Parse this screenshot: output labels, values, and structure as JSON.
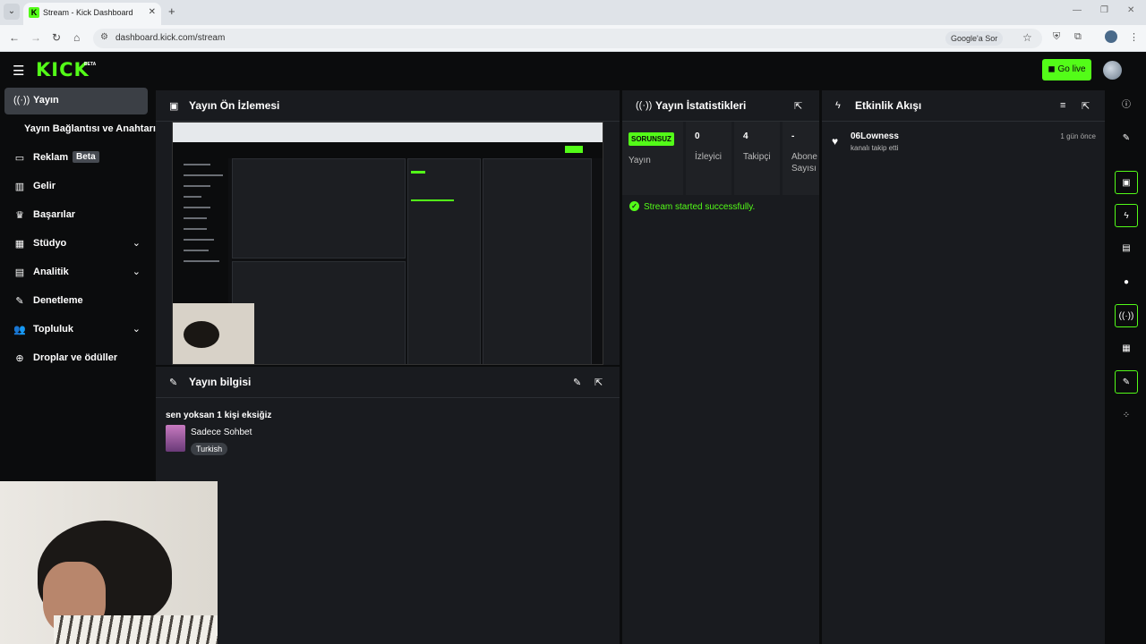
{
  "browser": {
    "tab_title": "Stream - Kick Dashboard",
    "url": "dashboard.kick.com/stream",
    "lens_chip": "Google'a Sor"
  },
  "header": {
    "logo": "KICK",
    "logo_badge": "BETA",
    "go_live_label": "Go live"
  },
  "sidebar": {
    "items": [
      {
        "label": "Yayın",
        "icon": "broadcast-icon"
      },
      {
        "label": "Yayın Bağlantısı ve Anahtarı"
      },
      {
        "label": "Reklam",
        "badge": "Beta",
        "icon": "tv-icon"
      },
      {
        "label": "Gelir",
        "icon": "chart-icon"
      },
      {
        "label": "Başarılar",
        "icon": "trophy-icon"
      },
      {
        "label": "Stüdyo",
        "icon": "studio-icon"
      },
      {
        "label": "Analitik",
        "icon": "analytics-icon"
      },
      {
        "label": "Denetleme",
        "icon": "wrench-icon"
      },
      {
        "label": "Topluluk",
        "icon": "users-icon"
      },
      {
        "label": "Droplar ve ödüller",
        "icon": "gift-icon"
      }
    ]
  },
  "preview": {
    "title": "Yayın Ön İzlemesi"
  },
  "stream_info": {
    "title": "Yayın bilgisi",
    "stream_title": "sen yoksan 1 kişi eksiğiz",
    "category": "Sadece Sohbet",
    "language": "Turkish"
  },
  "stats": {
    "title": "Yayın İstatistikleri",
    "status_badge": "SORUNSUZ",
    "status_label": "Yayın",
    "viewers_value": "0",
    "viewers_label": "İzleyici",
    "followers_value": "4",
    "followers_label": "Takipçi",
    "subs_value": "-",
    "subs_label": "Abone Sayısı",
    "success_message": "Stream started successfully."
  },
  "activity": {
    "title": "Etkinlik Akışı",
    "events": [
      {
        "user": "06Lowness",
        "desc": "kanalı takip etti",
        "time": "1 gün önce"
      }
    ]
  },
  "colors": {
    "accent": "#53fc18",
    "panel": "#191b1f",
    "background": "#0b0c0d"
  }
}
